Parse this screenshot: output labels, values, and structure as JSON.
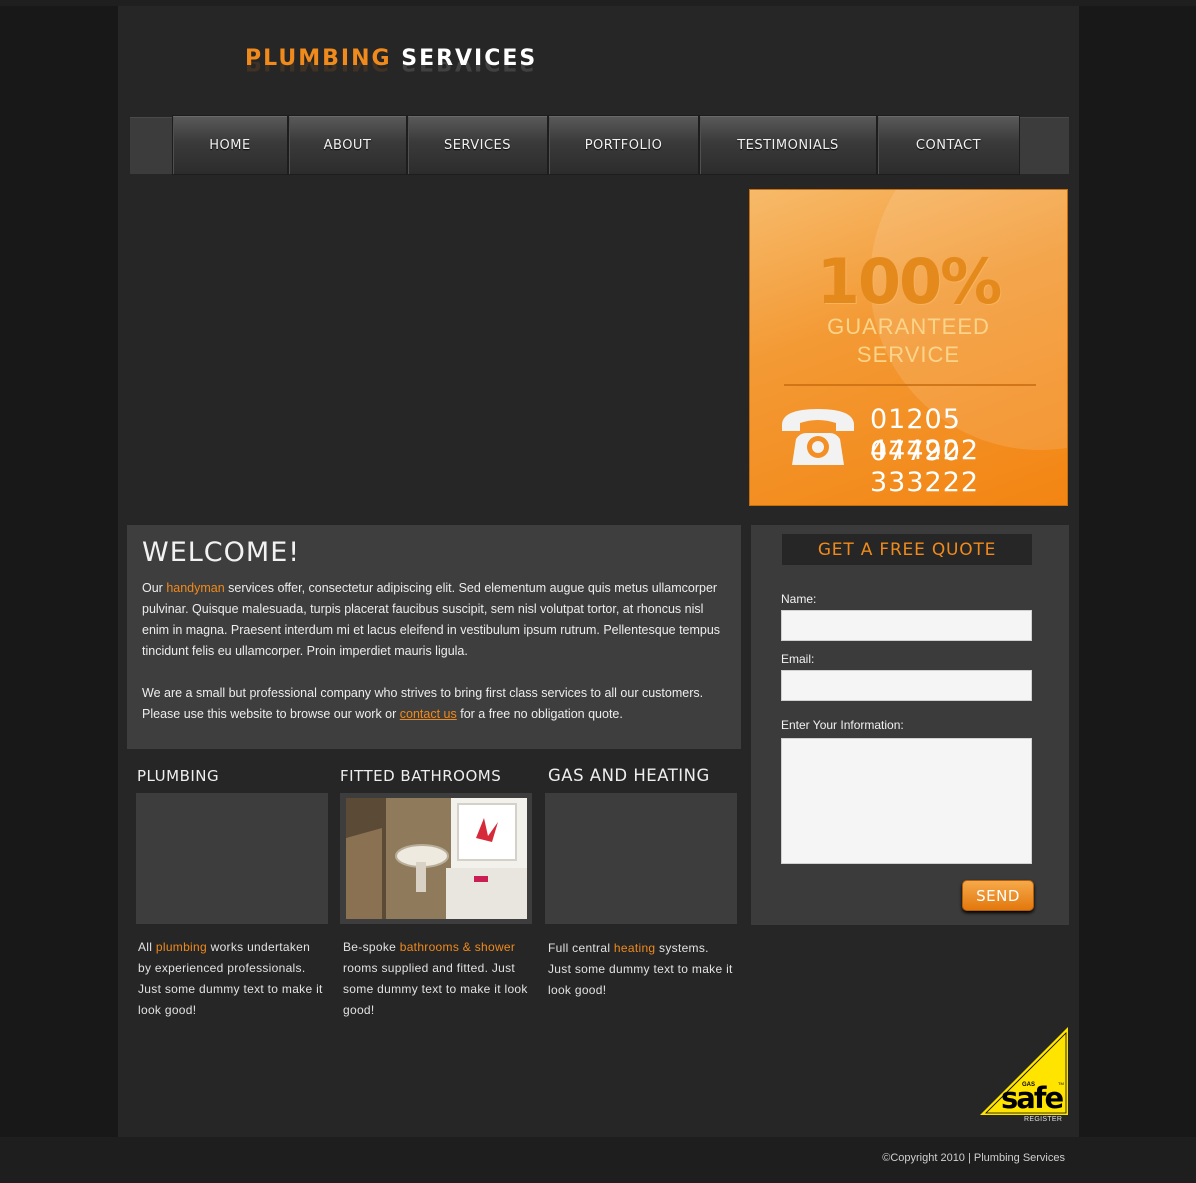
{
  "header": {
    "logo_part1": "PLUMBING",
    "logo_part2": "SERVICES"
  },
  "nav": {
    "items": [
      "HOME",
      "ABOUT",
      "SERVICES",
      "PORTFOLIO",
      "TESTIMONIALS",
      "CONTACT"
    ]
  },
  "promo": {
    "percent": "100%",
    "line1": "GUARANTEED",
    "line2": "SERVICE",
    "phone1": "01205 444222",
    "phone2": "07790 333222"
  },
  "welcome": {
    "heading": "WELCOME!",
    "p1_before": "Our ",
    "p1_highlight": "handyman",
    "p1_after": " services offer, consectetur adipiscing elit. Sed elementum augue quis metus ullamcorper pulvinar. Quisque malesuada, turpis placerat faucibus suscipit, sem nisl volutpat tortor, at rhoncus nisl enim in magna. Praesent interdum mi et lacus eleifend in vestibulum ipsum rutrum. Pellentesque tempus tincidunt felis eu ullamcorper. Proin imperdiet mauris ligula.",
    "p2_before": "We are a small but professional company who strives to bring first class services to all our customers. Please use this website to browse our work or ",
    "p2_link": "contact us",
    "p2_after": " for a free no obligation quote."
  },
  "services": [
    {
      "title": "PLUMBING",
      "text_before": "All ",
      "text_highlight": "plumbing",
      "text_after": " works undertaken by experienced professionals. Just some dummy text to make it look good!"
    },
    {
      "title": "FITTED BATHROOMS",
      "text_before": "Be-spoke ",
      "text_highlight": "bathrooms & shower",
      "text_after": " rooms supplied and fitted. Just some dummy text to make it look good!"
    },
    {
      "title": "GAS AND HEATING",
      "text_before": "Full central ",
      "text_highlight": "heating",
      "text_after": " systems. Just some dummy text to make it look good!"
    }
  ],
  "quote": {
    "title": "GET A FREE QUOTE",
    "name_label": "Name:",
    "name_value": "",
    "email_label": "Email:",
    "email_value": "",
    "info_label": "Enter Your Information:",
    "info_value": "",
    "send_label": "SEND"
  },
  "badge": {
    "gas": "GAS",
    "safe": "safe",
    "register": "REGISTER",
    "tm": "TM"
  },
  "footer": {
    "copyright": "©Copyright 2010 |  Plumbing Services"
  },
  "colors": {
    "accent": "#f08a1c",
    "page_bg": "#262626",
    "panel_bg": "#3e3e3e",
    "badge_yellow": "#ffe400"
  }
}
